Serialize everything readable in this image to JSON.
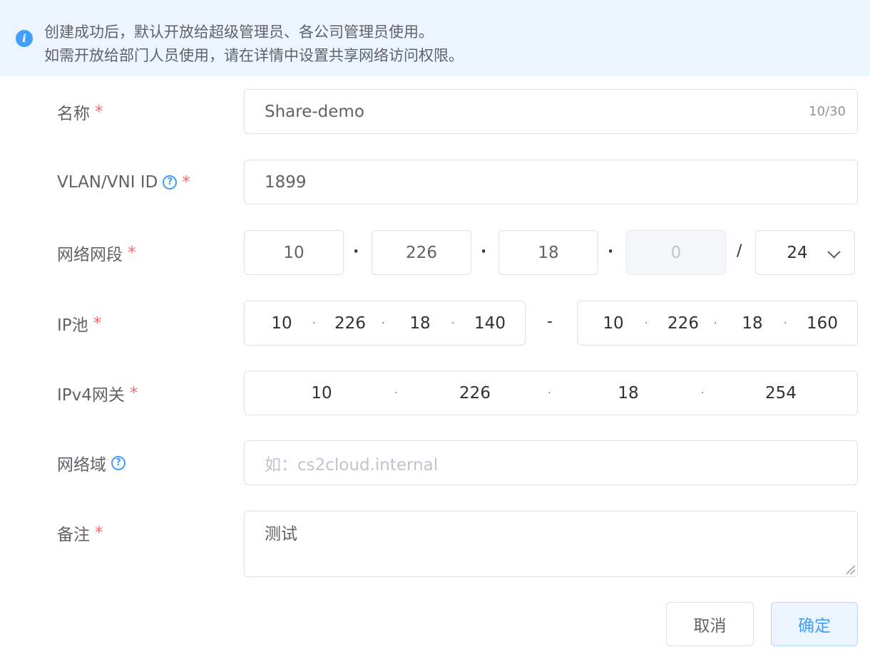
{
  "notice": {
    "line1": "创建成功后，默认开放给超级管理员、各公司管理员使用。",
    "line2": "如需开放给部门人员使用，请在详情中设置共享网络访问权限。",
    "icon": "info-icon"
  },
  "required_mark": "*",
  "help_glyph": "?",
  "form": {
    "name": {
      "label": "名称",
      "value": "Share-demo",
      "counter": "10/30"
    },
    "vlan": {
      "label": "VLAN/VNI ID",
      "value": "1899"
    },
    "segment": {
      "label": "网络网段",
      "octets": [
        "10",
        "226",
        "18",
        "0"
      ],
      "slash": "/",
      "mask": "24"
    },
    "ip_pool": {
      "label": "IP池",
      "start": [
        "10",
        "226",
        "18",
        "140"
      ],
      "dash": "-",
      "end": [
        "10",
        "226",
        "18",
        "160"
      ]
    },
    "gateway": {
      "label": "IPv4网关",
      "octets": [
        "10",
        "226",
        "18",
        "254"
      ]
    },
    "domain": {
      "label": "网络域",
      "placeholder": "如：cs2cloud.internal"
    },
    "remark": {
      "label": "备注",
      "value": "测试"
    }
  },
  "buttons": {
    "cancel": "取消",
    "confirm": "确定"
  },
  "colors": {
    "accent": "#409eff",
    "required": "#f56c6c",
    "notice_bg": "#ecf5ff"
  }
}
